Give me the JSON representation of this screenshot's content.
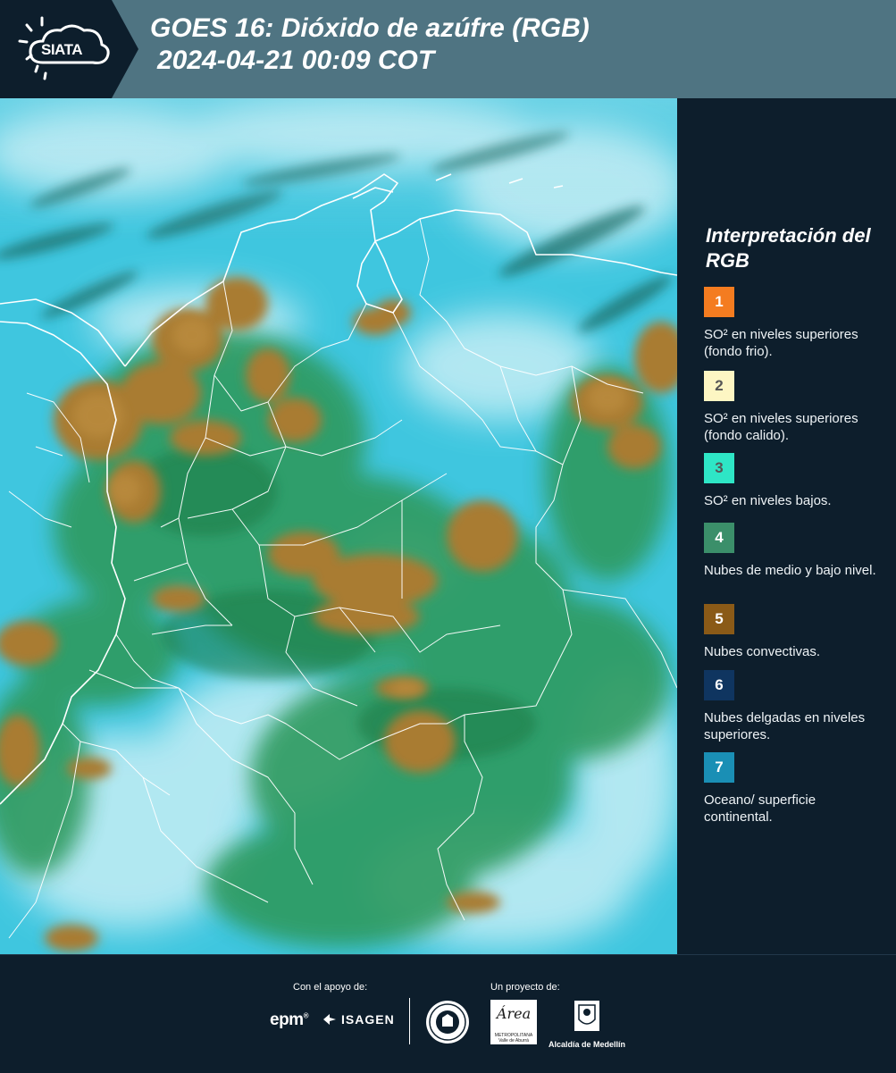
{
  "header": {
    "logo_text": "SIATA",
    "title_line1": "GOES 16: Dióxido de azúfre (RGB)",
    "title_line2": "2024-04-21 00:09 COT"
  },
  "legend": {
    "title": "Interpretación del RGB",
    "items": [
      {
        "number": "1",
        "color": "#f47c20",
        "number_color": "#ffffff",
        "description": "SO² en niveles superiores (fondo frio)."
      },
      {
        "number": "2",
        "color": "#fdf6c3",
        "number_color": "#555555",
        "description": "SO² en niveles superiores (fondo calido)."
      },
      {
        "number": "3",
        "color": "#2ee6c6",
        "number_color": "#555555",
        "description": "SO² en niveles bajos."
      },
      {
        "number": "4",
        "color": "#3b8f6a",
        "number_color": "#ffffff",
        "description": "Nubes de medio y bajo nivel."
      },
      {
        "number": "5",
        "color": "#8a5a17",
        "number_color": "#ffffff",
        "description": "Nubes convectivas."
      },
      {
        "number": "6",
        "color": "#0f3560",
        "number_color": "#ffffff",
        "description": "Nubes delgadas en niveles superiores."
      },
      {
        "number": "7",
        "color": "#1a8fb5",
        "number_color": "#ffffff",
        "description": "Oceano/ superficie continental."
      }
    ]
  },
  "footer": {
    "support_label": "Con el apoyo de:",
    "project_label": "Un proyecto de:",
    "sponsor_logos": [
      {
        "name": "epm",
        "text": "epm"
      },
      {
        "name": "isagen",
        "text": "ISAGEN"
      }
    ],
    "partner_logos": [
      {
        "name": "area-metropolitana",
        "text": "Área",
        "subtext": "METROPOLITANA Valle de Aburrá"
      },
      {
        "name": "alcaldia",
        "text": "Alcaldía de Medellín"
      }
    ]
  },
  "map": {
    "colors": {
      "ocean": "#3fc6df",
      "haze": "#bdeaf3",
      "low_cloud": "#2c8f5b",
      "convective": "#a87a32",
      "boundary": "#ffffff"
    }
  }
}
